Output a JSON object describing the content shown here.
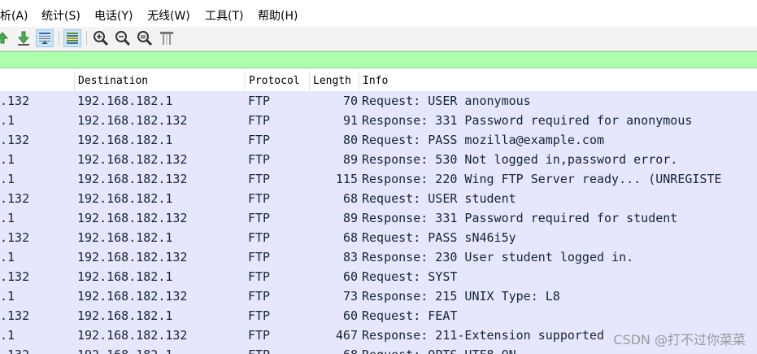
{
  "menu": [
    "析(A)",
    "统计(S)",
    "电话(Y)",
    "无线(W)",
    "工具(T)",
    "帮助(H)"
  ],
  "toolbar": {
    "icons": [
      "go-first-packet-icon",
      "go-last-packet-icon",
      "autoscroll-icon",
      "colorize-icon",
      "zoom-in-icon",
      "zoom-out-icon",
      "zoom-normal-icon",
      "resize-columns-icon"
    ]
  },
  "filter": {
    "value": ""
  },
  "columns": {
    "source": "",
    "destination": "Destination",
    "protocol": "Protocol",
    "length": "Length",
    "info": "Info"
  },
  "packets": [
    {
      "src": ".132",
      "dst": "192.168.182.1",
      "proto": "FTP",
      "len": "70",
      "info": "Request: USER anonymous"
    },
    {
      "src": ".1",
      "dst": "192.168.182.132",
      "proto": "FTP",
      "len": "91",
      "info": "Response: 331 Password required for anonymous"
    },
    {
      "src": ".132",
      "dst": "192.168.182.1",
      "proto": "FTP",
      "len": "80",
      "info": "Request: PASS mozilla@example.com"
    },
    {
      "src": ".1",
      "dst": "192.168.182.132",
      "proto": "FTP",
      "len": "89",
      "info": "Response: 530 Not logged in,password error."
    },
    {
      "src": ".1",
      "dst": "192.168.182.132",
      "proto": "FTP",
      "len": "115",
      "info": "Response: 220 Wing FTP Server ready... (UNREGISTE"
    },
    {
      "src": ".132",
      "dst": "192.168.182.1",
      "proto": "FTP",
      "len": "68",
      "info": "Request: USER student"
    },
    {
      "src": ".1",
      "dst": "192.168.182.132",
      "proto": "FTP",
      "len": "89",
      "info": "Response: 331 Password required for student"
    },
    {
      "src": ".132",
      "dst": "192.168.182.1",
      "proto": "FTP",
      "len": "68",
      "info": "Request: PASS sN46i5y"
    },
    {
      "src": ".1",
      "dst": "192.168.182.132",
      "proto": "FTP",
      "len": "83",
      "info": "Response: 230 User student logged in."
    },
    {
      "src": ".132",
      "dst": "192.168.182.1",
      "proto": "FTP",
      "len": "60",
      "info": "Request: SYST"
    },
    {
      "src": ".1",
      "dst": "192.168.182.132",
      "proto": "FTP",
      "len": "73",
      "info": "Response: 215 UNIX Type: L8"
    },
    {
      "src": ".132",
      "dst": "192.168.182.1",
      "proto": "FTP",
      "len": "60",
      "info": "Request: FEAT"
    },
    {
      "src": ".1",
      "dst": "192.168.182.132",
      "proto": "FTP",
      "len": "467",
      "info": "Response: 211-Extension supported"
    },
    {
      "src": ".132",
      "dst": "192.168.182.1",
      "proto": "FTP",
      "len": "68",
      "info": "Request: OPTS UTF8 ON"
    }
  ],
  "watermark": "CSDN @打不过你菜菜",
  "colors": {
    "row_bg": "#e7e6ff",
    "filter_bg": "#afffaf",
    "text": "#12272e"
  }
}
